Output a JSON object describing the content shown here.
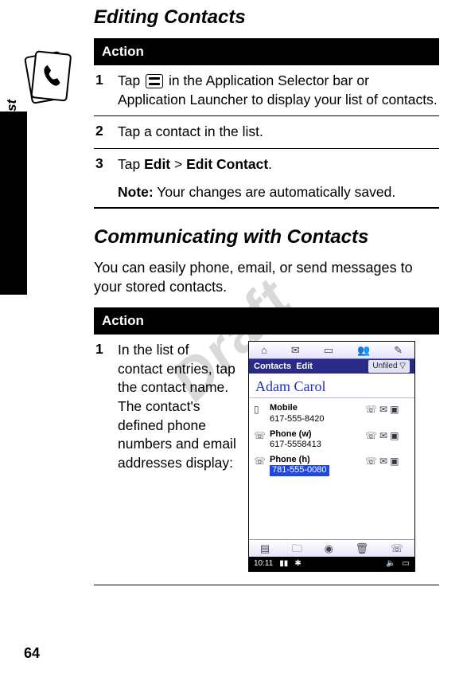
{
  "page_number": "64",
  "side_label": "Contact List",
  "watermark": "Draft",
  "section1": {
    "title": "Editing Contacts",
    "action_header": "Action",
    "steps": [
      {
        "num": "1",
        "pre": "Tap ",
        "post": " in the Application Selector bar or Application Launcher to display your list of contacts."
      },
      {
        "num": "2",
        "text": "Tap a contact in the list."
      },
      {
        "num": "3",
        "pre": "Tap ",
        "menu1": "Edit",
        "sep": " > ",
        "menu2": "Edit Contact",
        "post": "."
      }
    ],
    "note_label": "Note:",
    "note_text": " Your changes are automatically saved."
  },
  "section2": {
    "title": "Communicating with Contacts",
    "intro": "You can easily phone, email, or send messages to your stored contacts.",
    "action_header": "Action",
    "step": {
      "num": "1",
      "text": "In the list of contact entries, tap the contact name. The contact's defined phone numbers and email addresses display:"
    }
  },
  "device": {
    "menu_left1": "Contacts",
    "menu_left2": "Edit",
    "menu_right": "Unfiled ▽",
    "name": "Adam Carol",
    "rows": [
      {
        "label": "Mobile",
        "value": "617-555-8420"
      },
      {
        "label": "Phone (w)",
        "value": "617-5558413"
      },
      {
        "label": "Phone (h)",
        "value": "781-555-0080",
        "selected": true
      }
    ],
    "time": "10:11"
  }
}
